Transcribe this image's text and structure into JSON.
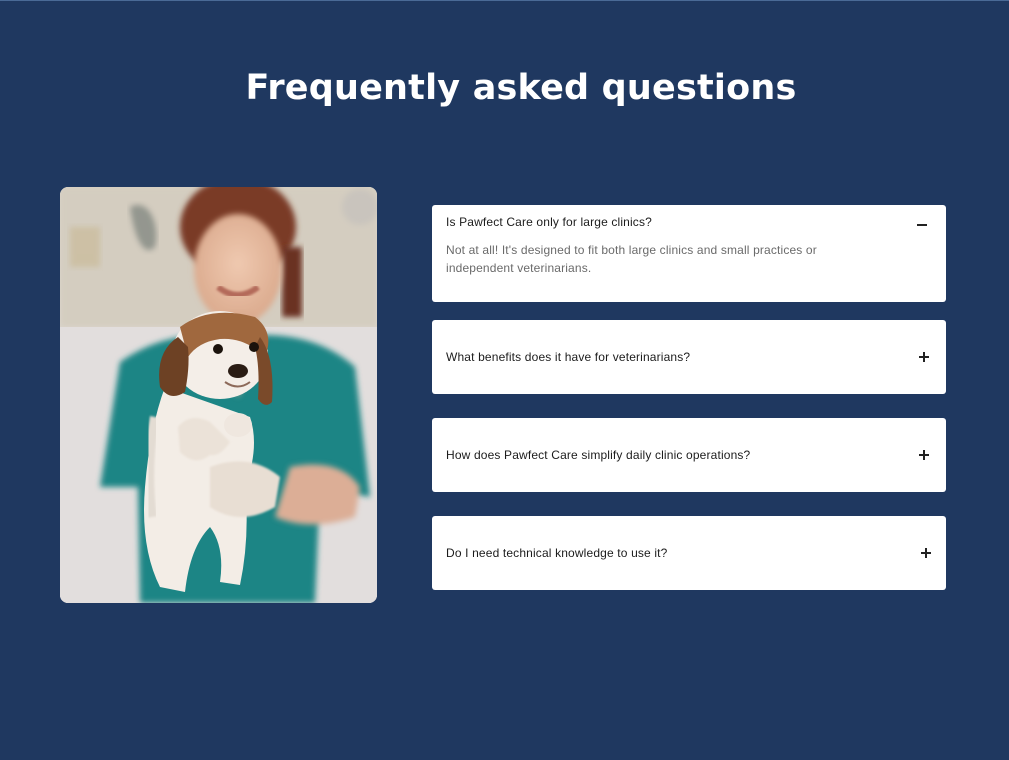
{
  "section": {
    "title": "Frequently asked questions"
  },
  "image": {
    "icon": "veterinarian-holding-puppy-photo"
  },
  "faq": {
    "items": [
      {
        "question": "Is Pawfect Care only for large clinics?",
        "answer": "Not at all! It's designed to fit both large clinics and small practices or independent veterinarians.",
        "expanded": true,
        "icon": "minus-icon"
      },
      {
        "question": "What benefits does it have for veterinarians?",
        "expanded": false,
        "icon": "plus-icon"
      },
      {
        "question": "How does Pawfect Care simplify daily clinic operations?",
        "expanded": false,
        "icon": "plus-icon"
      },
      {
        "question": "Do I need technical knowledge to use it?",
        "expanded": false,
        "icon": "plus-icon"
      }
    ]
  },
  "colors": {
    "background": "#1f3860",
    "card": "#ffffff",
    "question_text": "#1c1c1c",
    "answer_text": "#6a6a6a"
  }
}
